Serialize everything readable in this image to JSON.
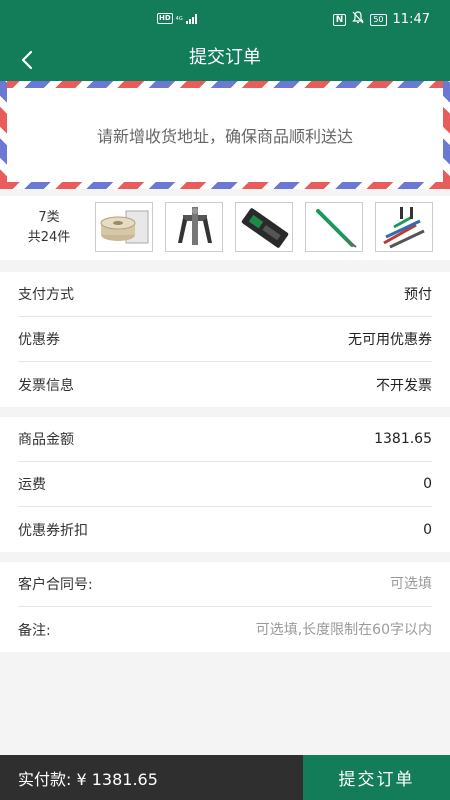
{
  "status_bar": {
    "left_badge": "HD",
    "network": "4G",
    "nfc": "N",
    "battery": "50",
    "time": "11:47"
  },
  "header": {
    "title": "提交订单",
    "back_icon": "chevron-left-icon"
  },
  "address": {
    "prompt": "请新增收货地址，确保商品顺利送达"
  },
  "goods": {
    "categories": "7类",
    "total": "共24件"
  },
  "order_info": {
    "rows": [
      {
        "label": "支付方式",
        "value": "预付"
      },
      {
        "label": "优惠券",
        "value": "无可用优惠券"
      },
      {
        "label": "发票信息",
        "value": "不开发票"
      }
    ]
  },
  "amounts": {
    "rows": [
      {
        "label": "商品金额",
        "value": "1381.65"
      },
      {
        "label": "运费",
        "value": "0"
      },
      {
        "label": "优惠券折扣",
        "value": "0"
      }
    ]
  },
  "extra": {
    "contract_label": "客户合同号:",
    "contract_placeholder": "可选填",
    "remark_label": "备注:",
    "remark_placeholder": "可选填,长度限制在60字以内"
  },
  "footer": {
    "total_label": "实付款: ¥ 1381.65",
    "submit_label": "提交订单"
  },
  "colors": {
    "brand": "#137d5a",
    "footer_dark": "#2f2f2f"
  }
}
